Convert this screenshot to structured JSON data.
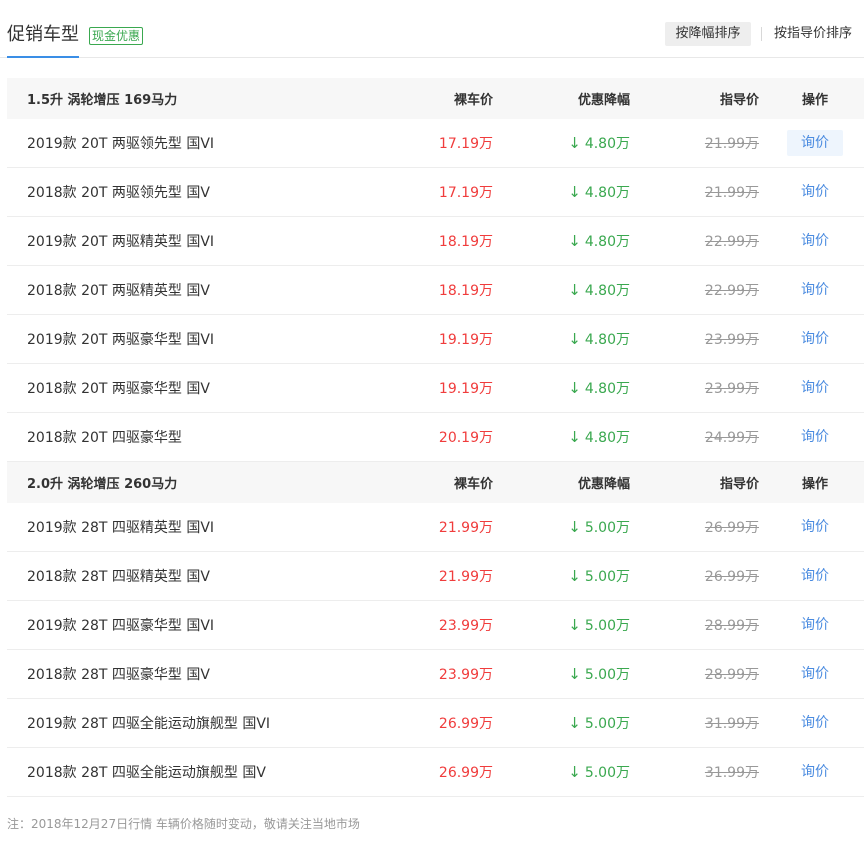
{
  "header": {
    "title": "促销车型",
    "badge": "现金优惠",
    "sort_active": "按降幅排序",
    "sort_other": "按指导价排序"
  },
  "columns": {
    "price": "裸车价",
    "discount": "优惠降幅",
    "guide": "指导价",
    "action": "操作"
  },
  "groups": [
    {
      "title": "1.5升 涡轮增压 169马力",
      "rows": [
        {
          "name": "2019款 20T 两驱领先型 国VI",
          "price": "17.19万",
          "discount": "4.80万",
          "guide": "21.99万",
          "action": "询价"
        },
        {
          "name": "2018款 20T 两驱领先型 国V",
          "price": "17.19万",
          "discount": "4.80万",
          "guide": "21.99万",
          "action": "询价"
        },
        {
          "name": "2019款 20T 两驱精英型 国VI",
          "price": "18.19万",
          "discount": "4.80万",
          "guide": "22.99万",
          "action": "询价"
        },
        {
          "name": "2018款 20T 两驱精英型 国V",
          "price": "18.19万",
          "discount": "4.80万",
          "guide": "22.99万",
          "action": "询价"
        },
        {
          "name": "2019款 20T 两驱豪华型 国VI",
          "price": "19.19万",
          "discount": "4.80万",
          "guide": "23.99万",
          "action": "询价"
        },
        {
          "name": "2018款 20T 两驱豪华型 国V",
          "price": "19.19万",
          "discount": "4.80万",
          "guide": "23.99万",
          "action": "询价"
        },
        {
          "name": "2018款 20T 四驱豪华型",
          "price": "20.19万",
          "discount": "4.80万",
          "guide": "24.99万",
          "action": "询价"
        }
      ]
    },
    {
      "title": "2.0升 涡轮增压 260马力",
      "rows": [
        {
          "name": "2019款 28T 四驱精英型 国VI",
          "price": "21.99万",
          "discount": "5.00万",
          "guide": "26.99万",
          "action": "询价"
        },
        {
          "name": "2018款 28T 四驱精英型 国V",
          "price": "21.99万",
          "discount": "5.00万",
          "guide": "26.99万",
          "action": "询价"
        },
        {
          "name": "2019款 28T 四驱豪华型 国VI",
          "price": "23.99万",
          "discount": "5.00万",
          "guide": "28.99万",
          "action": "询价"
        },
        {
          "name": "2018款 28T 四驱豪华型 国V",
          "price": "23.99万",
          "discount": "5.00万",
          "guide": "28.99万",
          "action": "询价"
        },
        {
          "name": "2019款 28T 四驱全能运动旗舰型 国VI",
          "price": "26.99万",
          "discount": "5.00万",
          "guide": "31.99万",
          "action": "询价"
        },
        {
          "name": "2018款 28T 四驱全能运动旗舰型 国V",
          "price": "26.99万",
          "discount": "5.00万",
          "guide": "31.99万",
          "action": "询价"
        }
      ]
    }
  ],
  "note": "注：2018年12月27日行情 车辆价格随时变动，敬请关注当地市场",
  "icons": {
    "discount_arrow": "arrow-down-icon"
  },
  "colors": {
    "accent": "#3a8ee6",
    "price": "#f03c3c",
    "discount": "#3aa84f",
    "link": "#4a8be0"
  }
}
